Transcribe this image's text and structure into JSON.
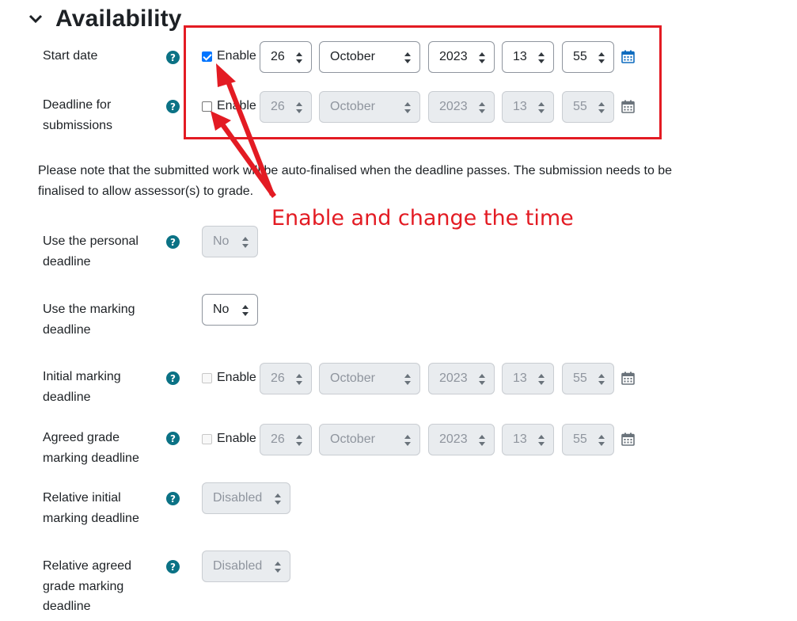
{
  "section": {
    "title": "Availability"
  },
  "enable_label": "Enable",
  "rows": {
    "start_date": {
      "label": "Start date",
      "enabled": true,
      "day": "26",
      "month": "October",
      "year": "2023",
      "hour": "13",
      "minute": "55"
    },
    "deadline": {
      "label": "Deadline for submissions",
      "enabled": false,
      "day": "26",
      "month": "October",
      "year": "2023",
      "hour": "13",
      "minute": "55"
    },
    "initial_marking": {
      "label": "Initial marking deadline",
      "enabled": false,
      "day": "26",
      "month": "October",
      "year": "2023",
      "hour": "13",
      "minute": "55"
    },
    "agreed_marking": {
      "label": "Agreed grade marking deadline",
      "enabled": false,
      "day": "26",
      "month": "October",
      "year": "2023",
      "hour": "13",
      "minute": "55"
    }
  },
  "note": "Please note that the submitted work will be auto-finalised when the deadline passes. The submission needs to be finalised to allow assessor(s) to grade.",
  "personal_deadline": {
    "label": "Use the personal deadline",
    "value": "No"
  },
  "marking_deadline": {
    "label": "Use the marking deadline",
    "value": "No"
  },
  "relative_initial": {
    "label": "Relative initial marking deadline",
    "value": "Disabled"
  },
  "relative_agreed": {
    "label": "Relative agreed grade marking deadline",
    "value": "Disabled"
  },
  "annotation": {
    "text": "Enable and change the time",
    "color": "#e31b23"
  },
  "colors": {
    "help_icon": "#0b7285",
    "checkbox_checked": "#0075ff",
    "calendar_icon": "#0f6cbf"
  }
}
